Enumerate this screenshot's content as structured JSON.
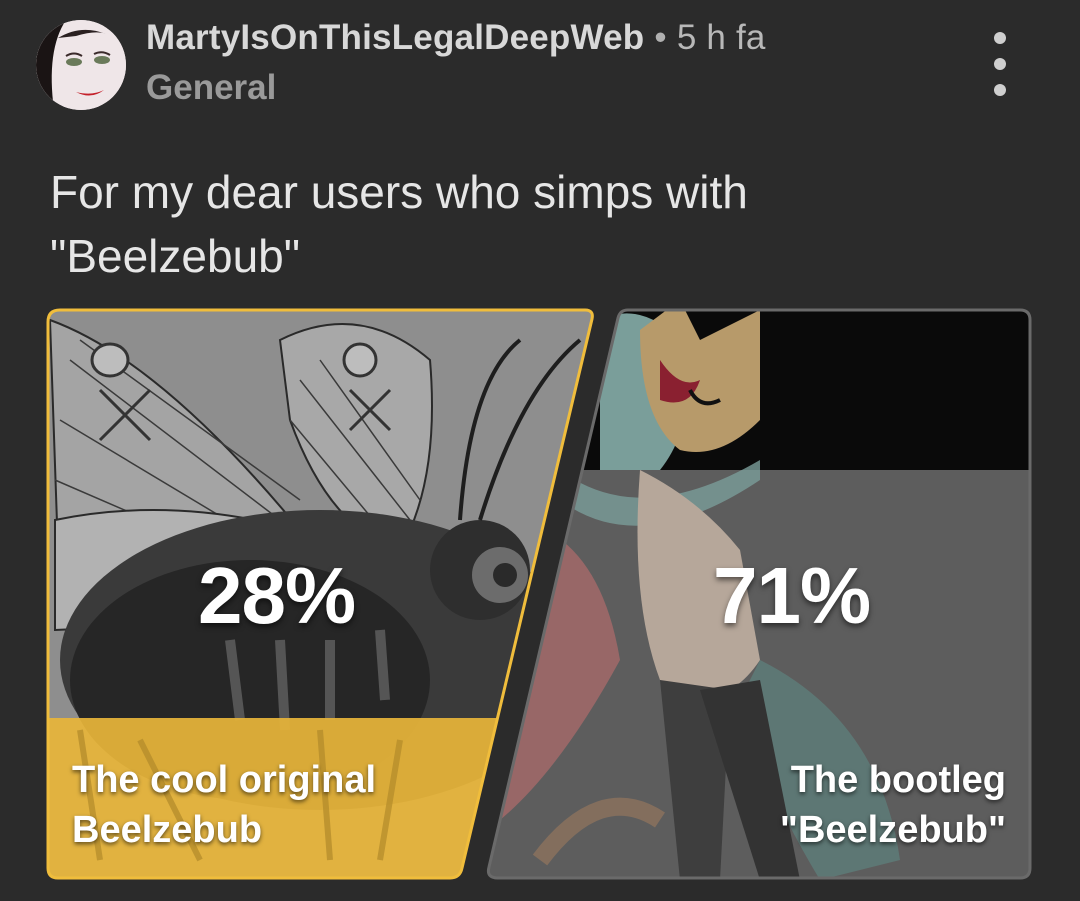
{
  "post": {
    "author": "MartyIsOnThisLegalDeepWeb",
    "separator": "•",
    "time_ago": "5 h fa",
    "community": "General",
    "title_line1": "For my dear users who simps with",
    "title_line2": "\"Beelzebub\""
  },
  "poll": {
    "options": [
      {
        "percent_label": "28%",
        "percent": 28,
        "label_line1": "The cool original",
        "label_line2": "Beelzebub",
        "selected": true
      },
      {
        "percent_label": "71%",
        "percent": 71,
        "label_line1": "The bootleg",
        "label_line2": "\"Beelzebub\"",
        "selected": false
      }
    ]
  },
  "colors": {
    "background": "#2b2b2b",
    "accent_selected": "#e8b53a",
    "text_primary": "#e6e6e6",
    "text_secondary": "#9a9a9a"
  },
  "icons": {
    "more": "vertical-ellipsis-icon",
    "avatar": "user-avatar"
  }
}
